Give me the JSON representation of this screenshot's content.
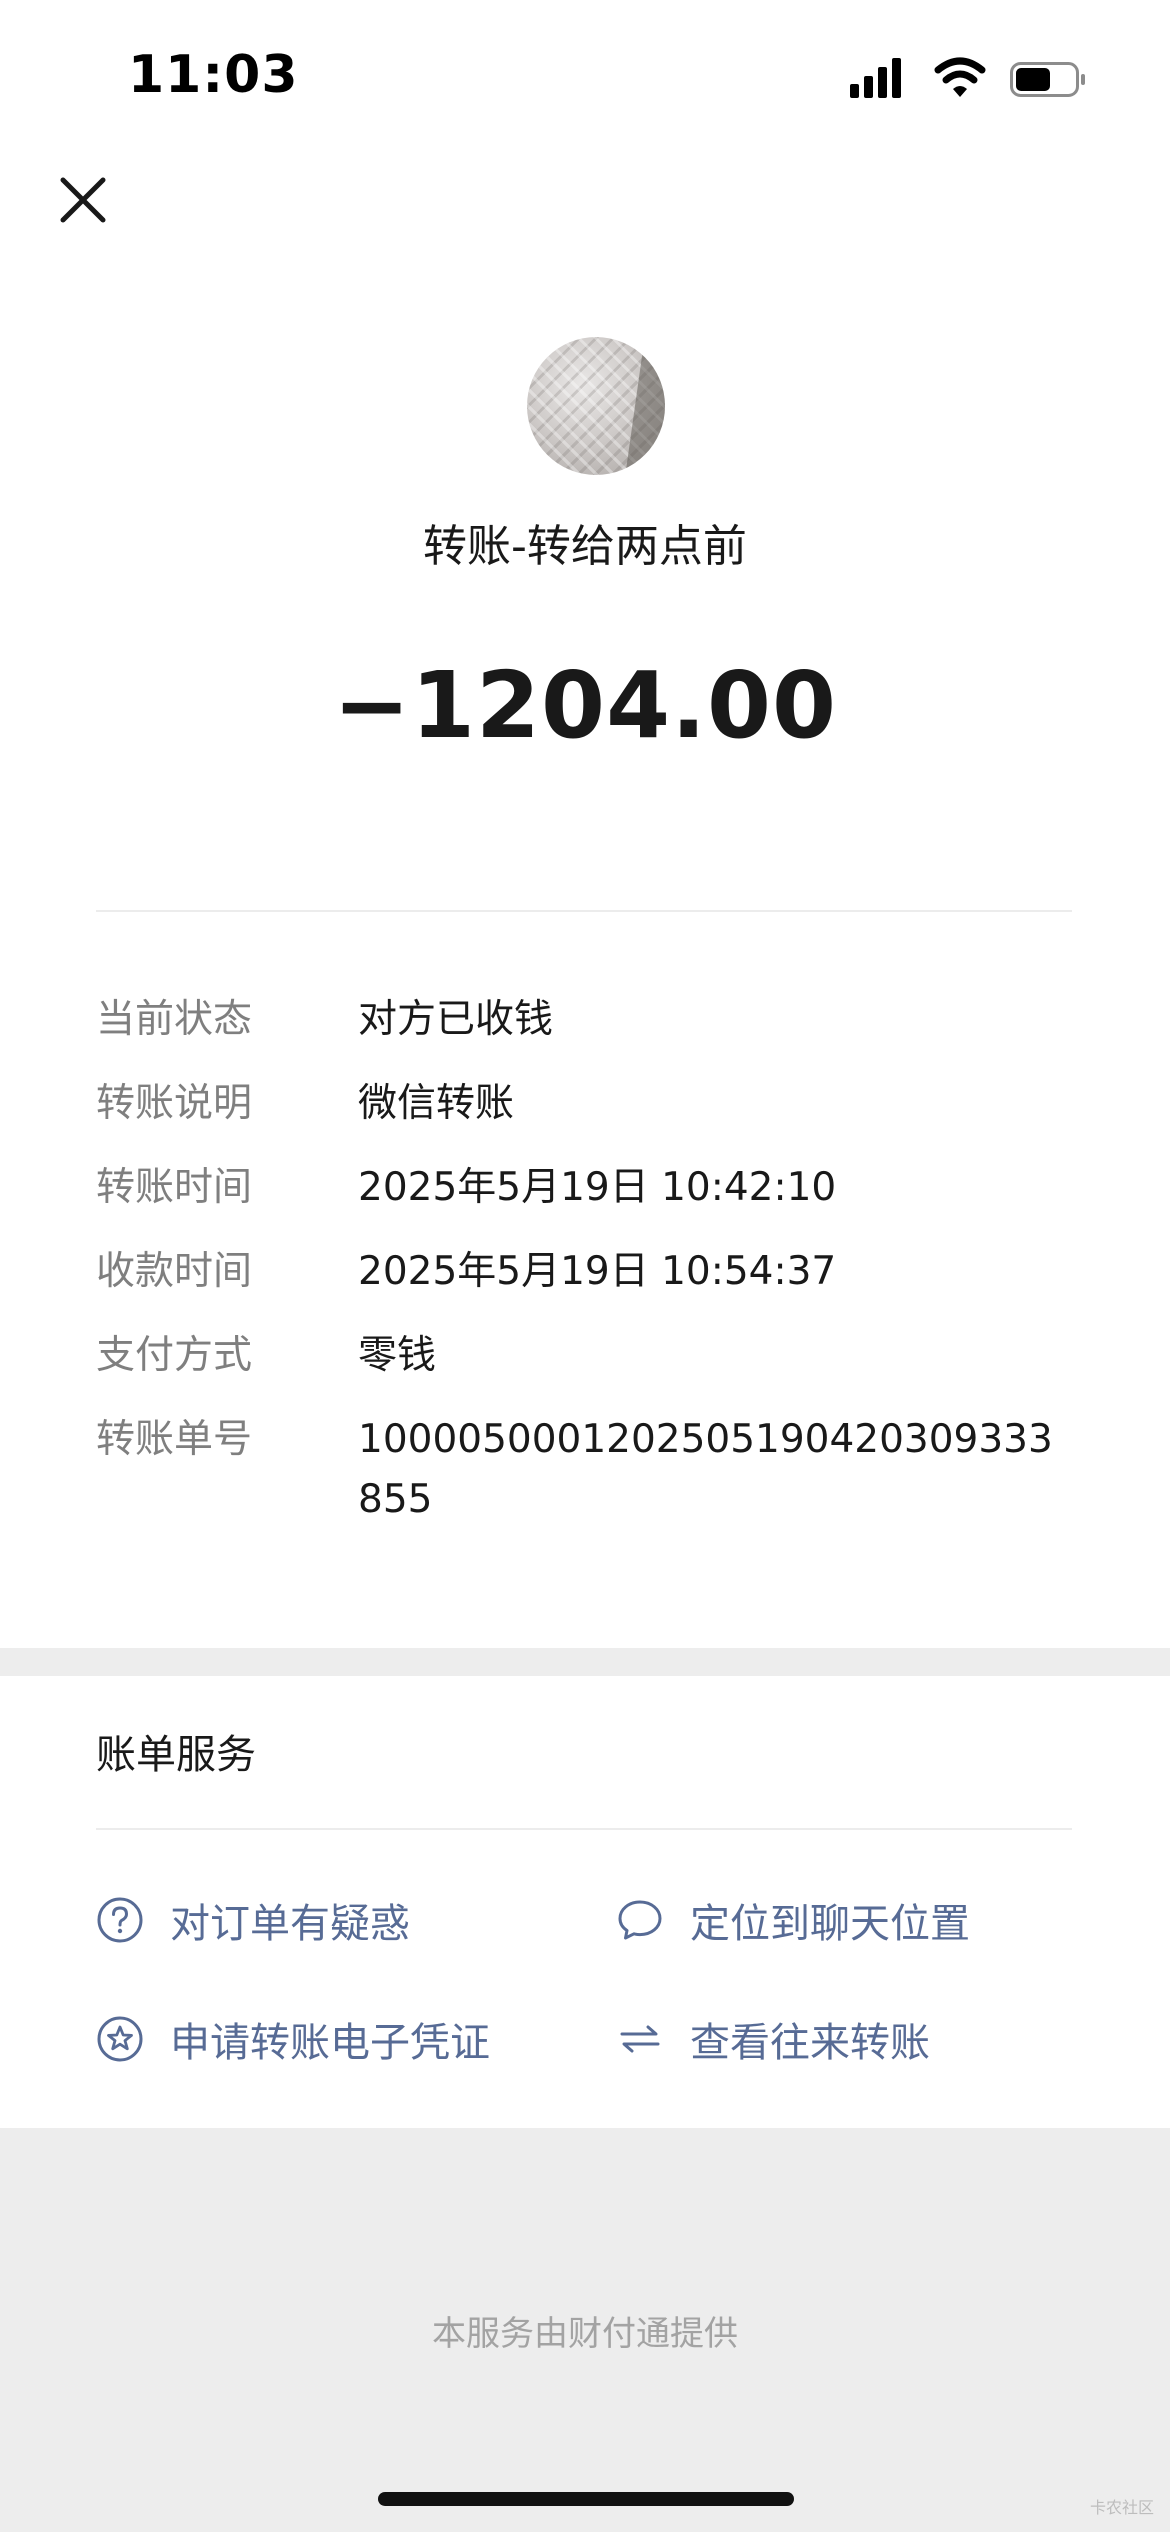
{
  "status_bar": {
    "time": "11:03",
    "icons": [
      "signal-icon",
      "wifi-icon",
      "battery-icon"
    ]
  },
  "header": {
    "close_icon": "close-icon"
  },
  "transfer": {
    "title": "转账-转给两点前",
    "amount": "−1204.00"
  },
  "details": [
    {
      "label": "当前状态",
      "value": "对方已收钱"
    },
    {
      "label": "转账说明",
      "value": "微信转账"
    },
    {
      "label": "转账时间",
      "value": "2025年5月19日 10:42:10"
    },
    {
      "label": "收款时间",
      "value": "2025年5月19日 10:54:37"
    },
    {
      "label": "支付方式",
      "value": "零钱"
    },
    {
      "label": "转账单号",
      "value": "1000050001202505190420309333855"
    }
  ],
  "services": {
    "title": "账单服务",
    "items": [
      {
        "label": "对订单有疑惑",
        "icon": "question-circle-icon"
      },
      {
        "label": "定位到聊天位置",
        "icon": "chat-bubble-icon"
      },
      {
        "label": "申请转账电子凭证",
        "icon": "star-circle-icon"
      },
      {
        "label": "查看往来转账",
        "icon": "swap-arrows-icon"
      }
    ]
  },
  "footer": {
    "provider_text": "本服务由财付通提供",
    "watermark": "卡农社区"
  },
  "colors": {
    "link": "#576b95",
    "label_gray": "#7f7f7f",
    "band_gray": "#ededed"
  }
}
